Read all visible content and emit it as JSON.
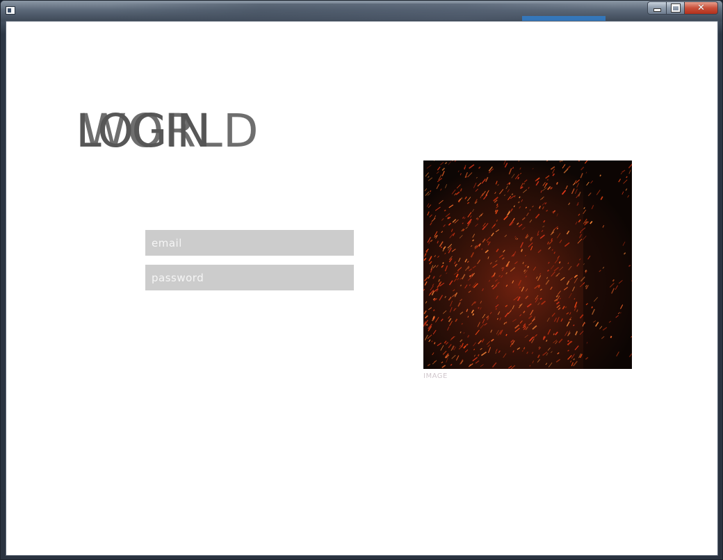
{
  "window": {
    "title": "",
    "controls": {
      "minimize": "minimize",
      "maximize": "maximize",
      "close": "close"
    }
  },
  "logo": {
    "word_a": "LOGIN",
    "word_b": "WORLD"
  },
  "form": {
    "email_placeholder": "email",
    "password_placeholder": "password"
  },
  "image": {
    "caption": "IMAGE",
    "icon": "fire-sparks-photo"
  },
  "colors": {
    "field_bg": "#cccccc",
    "placeholder": "#f5f5f5",
    "logo_text": "#3a3a3a",
    "spark": "#ff4a14"
  }
}
